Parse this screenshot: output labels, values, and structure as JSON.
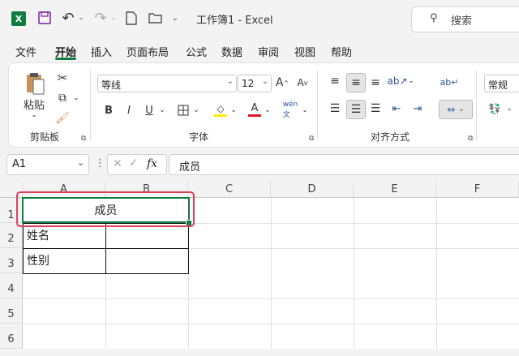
{
  "app": {
    "title": "工作簿1 - Excel",
    "search_label": "搜索"
  },
  "tabs": [
    "文件",
    "开始",
    "插入",
    "页面布局",
    "公式",
    "数据",
    "审阅",
    "视图",
    "帮助"
  ],
  "ribbon": {
    "clipboard": {
      "paste": "粘贴",
      "label": "剪贴板"
    },
    "font": {
      "name": "等线",
      "size": "12",
      "label": "字体"
    },
    "alignment": {
      "label": "对齐方式"
    },
    "number": {
      "format": "常规"
    }
  },
  "formula_bar": {
    "name_box": "A1",
    "fx": "fx",
    "content": "成员"
  },
  "columns": [
    "A",
    "B",
    "C",
    "D",
    "E",
    "F"
  ],
  "rows": [
    "1",
    "2",
    "3",
    "4",
    "5",
    "6"
  ],
  "cells": {
    "A1": "成员",
    "A2": "姓名",
    "A3": "性别"
  },
  "colors": {
    "accent": "#107c41",
    "highlight": "#e0415a"
  }
}
